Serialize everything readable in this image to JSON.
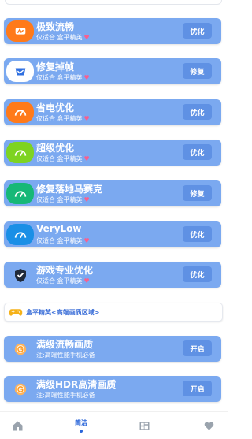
{
  "cards": [
    {
      "title": "极致流畅",
      "subtitle": "仅适合 盒平精英",
      "heart": "♥",
      "action": "优化",
      "icon": "speed-icon",
      "icon_bg": "#ff7a1a"
    },
    {
      "title": "修复掉帧",
      "subtitle": "仅适合 盒平精英",
      "heart": "♥",
      "action": "修复",
      "icon": "frame-icon",
      "icon_bg": "#2f6fe0"
    },
    {
      "title": "省电优化",
      "subtitle": "仅适合 盒平精英",
      "heart": "♥",
      "action": "优化",
      "icon": "gauge-icon",
      "icon_bg": "#ff7a1a"
    },
    {
      "title": "超级优化",
      "subtitle": "仅适合 盒平精英",
      "heart": "♥",
      "action": "优化",
      "icon": "gauge-icon",
      "icon_bg": "#7ed321"
    },
    {
      "title": "修复落地马赛克",
      "subtitle": "仅适合 盒平精英",
      "heart": "♥",
      "action": "修复",
      "icon": "gauge-icon",
      "icon_bg": "#16b877"
    },
    {
      "title": "VeryLow",
      "subtitle": "仅适合 盒平精英",
      "heart": "♥",
      "action": "优化",
      "icon": "gauge-icon",
      "icon_bg": "#1a8fe6"
    },
    {
      "title": "游戏专业优化",
      "subtitle": "仅适合 盒平精英",
      "heart": "♥",
      "action": "优化",
      "icon": "shield-check-icon",
      "icon_bg": "#7ba9f0"
    }
  ],
  "section": {
    "title": "盒平精英<高端画质区域>",
    "icon": "gamepad-icon"
  },
  "premium_cards": [
    {
      "title": "满级流畅画质",
      "subtitle": "注:高端性能手机必备",
      "action": "开启",
      "icon": "g-badge-icon",
      "icon_bg": "#ffb35a"
    },
    {
      "title": "满级HDR高清画质",
      "subtitle": "注:高端性能手机必备",
      "action": "开启",
      "icon": "g-badge-icon",
      "icon_bg": "#ffb35a"
    }
  ],
  "nav": {
    "active_label": "简洁",
    "items": [
      "home-icon",
      "simple-tab",
      "layers-icon",
      "heart-icon"
    ]
  },
  "colors": {
    "card_bg": "#7ba9f0",
    "button_bg": "#5f91e4",
    "accent": "#2b66d9",
    "heart": "#ff5c8a"
  }
}
